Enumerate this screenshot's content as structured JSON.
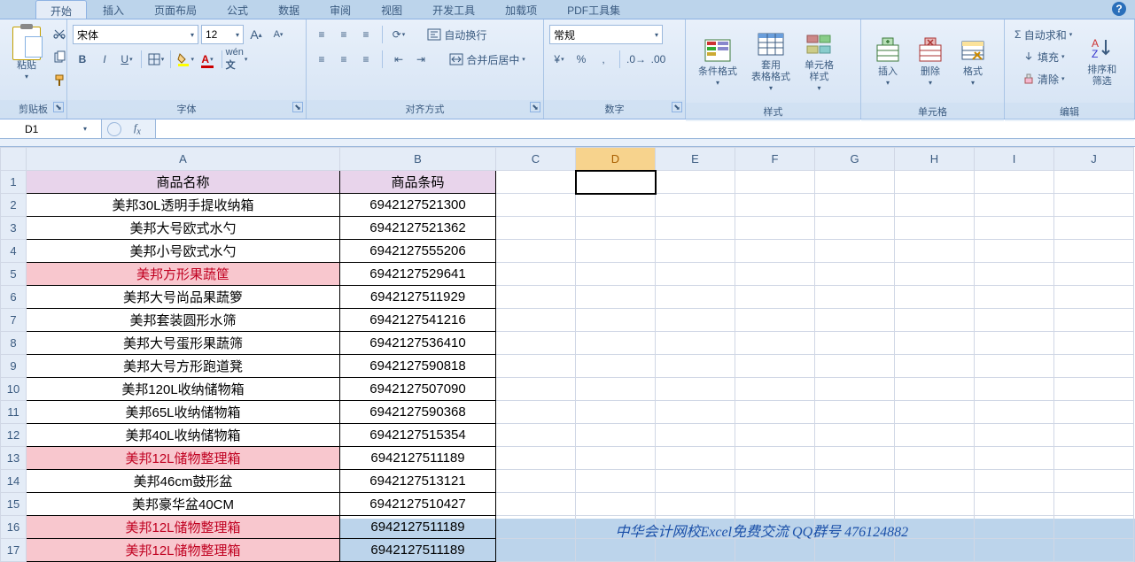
{
  "tabs": [
    "开始",
    "插入",
    "页面布局",
    "公式",
    "数据",
    "审阅",
    "视图",
    "开发工具",
    "加载项",
    "PDF工具集"
  ],
  "activeTab": 0,
  "groups": {
    "clipboard": {
      "title": "剪贴板",
      "paste": "粘贴"
    },
    "font": {
      "title": "字体",
      "name": "宋体",
      "size": "12"
    },
    "align": {
      "title": "对齐方式",
      "wrap": "自动换行",
      "merge": "合并后居中"
    },
    "number": {
      "title": "数字",
      "format": "常规"
    },
    "styles": {
      "title": "样式",
      "cond": "条件格式",
      "table": "套用\n表格格式",
      "cell": "单元格\n样式"
    },
    "cells": {
      "title": "单元格",
      "insert": "插入",
      "delete": "删除",
      "format": "格式"
    },
    "editing": {
      "title": "编辑",
      "sum": "自动求和",
      "fill": "填充",
      "clear": "清除",
      "sort": "排序和\n筛选"
    }
  },
  "nameBox": "D1",
  "cols": [
    "A",
    "B",
    "C",
    "D",
    "E",
    "F",
    "G",
    "H",
    "I",
    "J"
  ],
  "headerRow": {
    "a": "商品名称",
    "b": "商品条码"
  },
  "rows": [
    {
      "a": "美邦30L透明手提收纳箱",
      "b": "6942127521300"
    },
    {
      "a": "美邦大号欧式水勺",
      "b": "6942127521362"
    },
    {
      "a": "美邦小号欧式水勺",
      "b": "6942127555206"
    },
    {
      "a": "美邦方形果蔬筐",
      "b": "6942127529641",
      "hl": true
    },
    {
      "a": "美邦大号尚品果蔬箩",
      "b": "6942127511929"
    },
    {
      "a": "美邦套装圆形水筛",
      "b": "6942127541216"
    },
    {
      "a": "美邦大号蛋形果蔬筛",
      "b": "6942127536410"
    },
    {
      "a": "美邦大号方形跑道凳",
      "b": "6942127590818"
    },
    {
      "a": "美邦120L收纳储物箱",
      "b": "6942127507090"
    },
    {
      "a": "美邦65L收纳储物箱",
      "b": "6942127590368"
    },
    {
      "a": "美邦40L收纳储物箱",
      "b": "6942127515354"
    },
    {
      "a": "美邦12L储物整理箱",
      "b": "6942127511189",
      "hl": true
    },
    {
      "a": "美邦46cm鼓形盆",
      "b": "6942127513121"
    },
    {
      "a": "美邦豪华盆40CM",
      "b": "6942127510427"
    },
    {
      "a": "美邦12L储物整理箱",
      "b": "6942127511189",
      "hl": true
    },
    {
      "a": "美邦12L储物整理箱",
      "b": "6942127511189",
      "hl": true
    }
  ],
  "footerText": "中华会计网校Excel免费交流  QQ群号   476124882",
  "selectedCell": "D1"
}
